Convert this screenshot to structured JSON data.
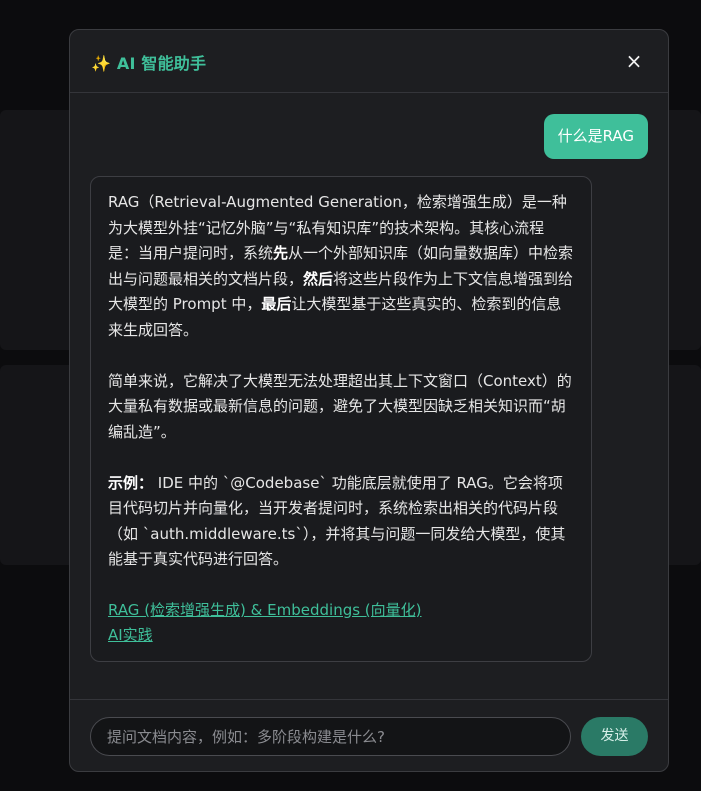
{
  "modal": {
    "title": "✨ AI 智能助手",
    "close_label": "×"
  },
  "chat": {
    "user_message": "什么是RAG",
    "bot_message": {
      "p1": [
        {
          "t": "RAG（Retrieval-Augmented Generation，检索增强生成）是一种为大模型外挂“记忆外脑”与“私有知识库”的技术架构。其核心流程是：当用户提问时，系统",
          "b": false
        },
        {
          "t": "先",
          "b": true
        },
        {
          "t": "从一个外部知识库（如向量数据库）中检索出与问题最相关的文档片段，",
          "b": false
        },
        {
          "t": "然后",
          "b": true
        },
        {
          "t": "将这些片段作为上下文信息增强到给大模型的 Prompt 中，",
          "b": false
        },
        {
          "t": "最后",
          "b": true
        },
        {
          "t": "让大模型基于这些真实的、检索到的信息来生成回答。",
          "b": false
        }
      ],
      "p2": "简单来说，它解决了大模型无法处理超出其上下文窗口（Context）的大量私有数据或最新信息的问题，避免了大模型因缺乏相关知识而“胡编乱造”。",
      "p3_label": "示例：",
      "p3": " IDE 中的 `@Codebase` 功能底层就使用了 RAG。它会将项目代码切片并向量化，当开发者提问时，系统检索出相关的代码片段（如 `auth.middleware.ts`），并将其与问题一同发给大模型，使其能基于真实代码进行回答。",
      "links": [
        "RAG (检索增强生成) & Embeddings (向量化)",
        "AI实践"
      ]
    }
  },
  "input": {
    "placeholder": "提问文档内容，例如：多阶段构建是什么?",
    "value": "",
    "send_label": "发送"
  },
  "colors": {
    "accent": "#3fbf9a",
    "send_button": "#2a7a66",
    "modal_bg": "#1d1e21"
  }
}
